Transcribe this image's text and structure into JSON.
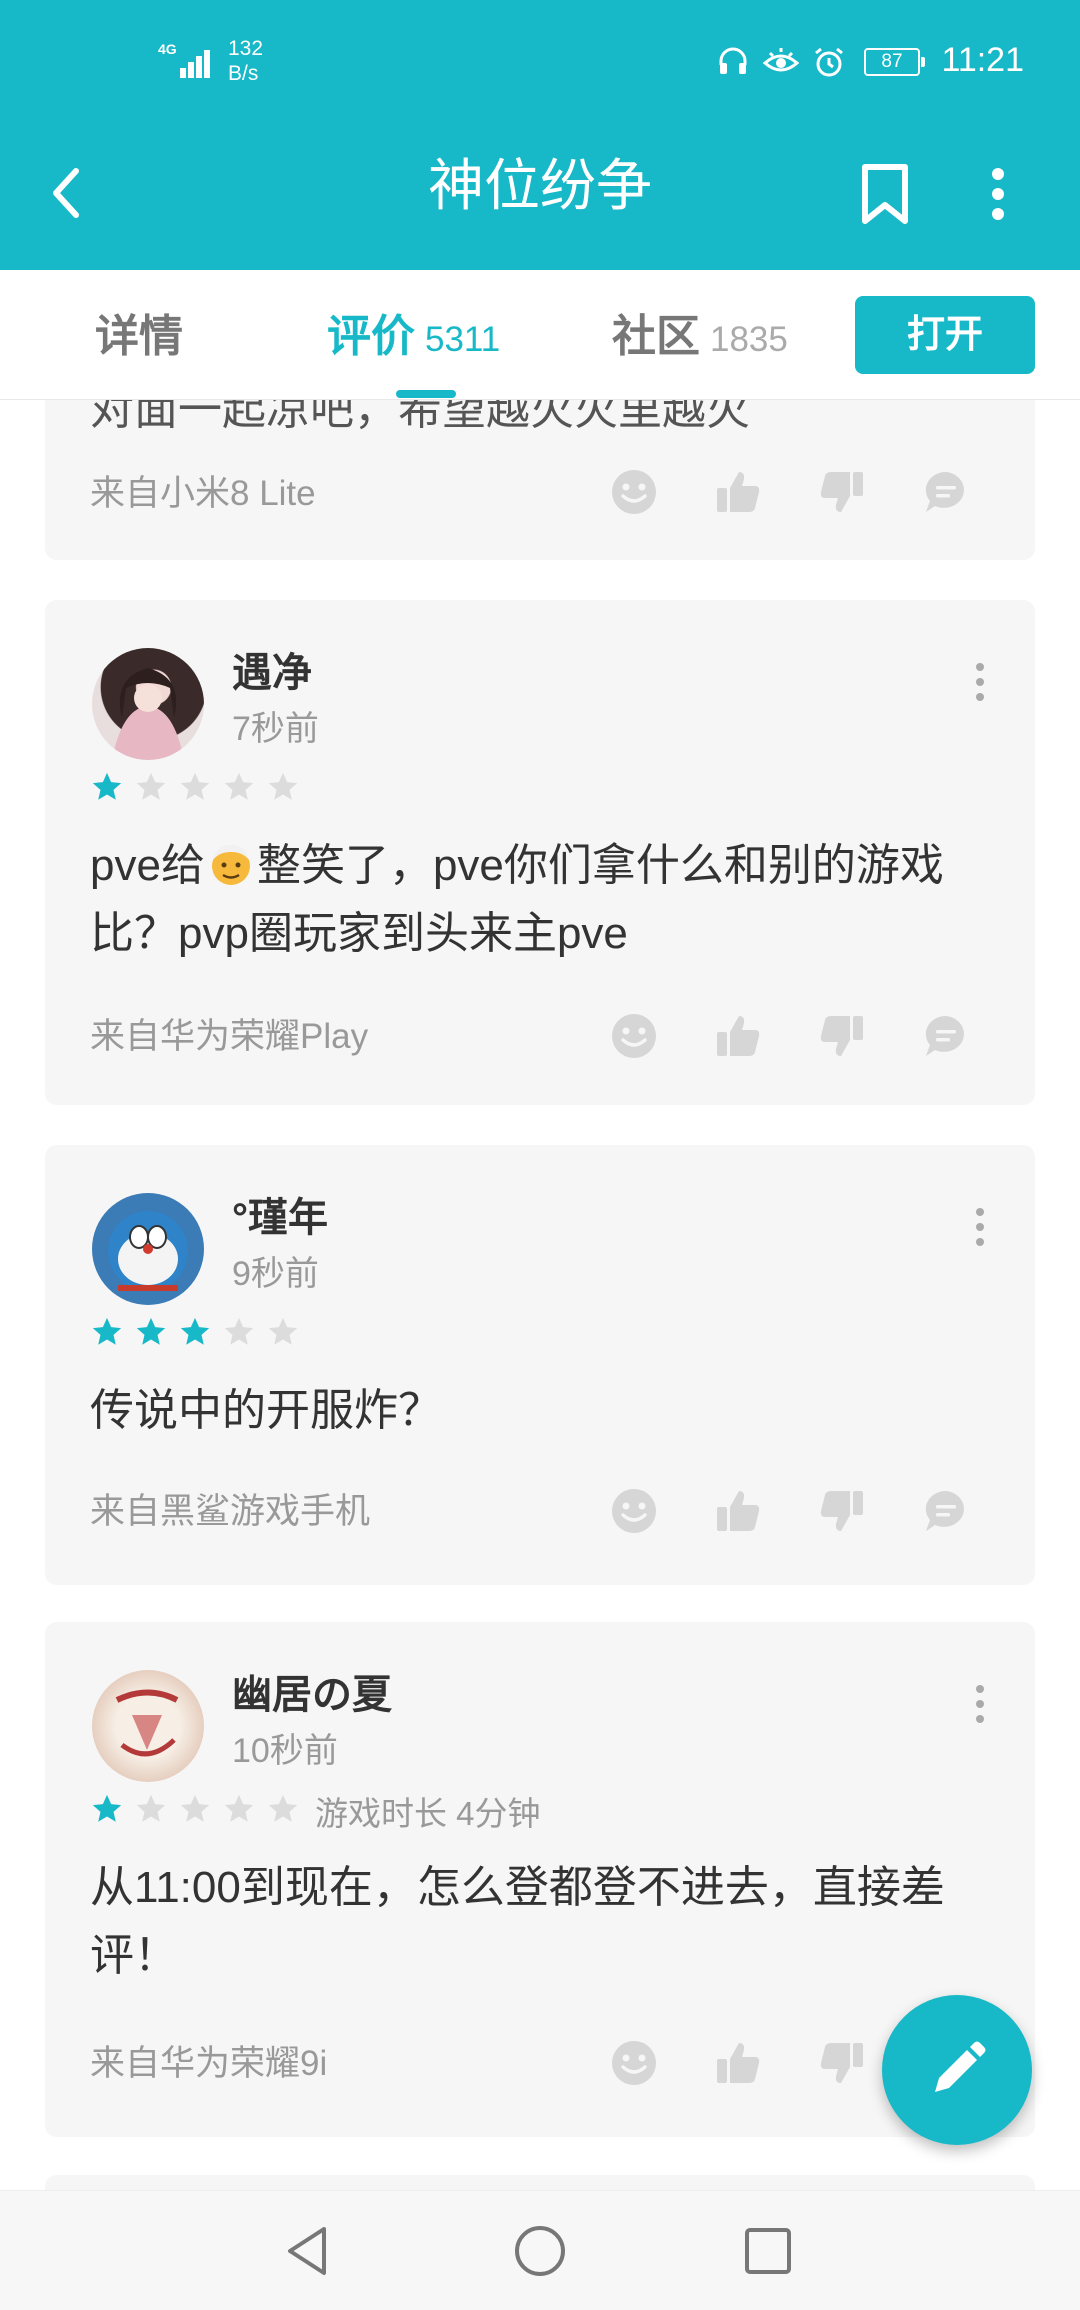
{
  "status_bar": {
    "network_type": "4G",
    "net_speed_value": "132",
    "net_speed_unit": "B/s",
    "battery": "87",
    "time": "11:21"
  },
  "app_bar": {
    "title": "神位纷争"
  },
  "tabs": [
    {
      "label": "详情",
      "count": ""
    },
    {
      "label": "评价",
      "count": "5311"
    },
    {
      "label": "社区",
      "count": "1835"
    }
  ],
  "active_tab": "评价",
  "open_button": "打开",
  "partial_review": {
    "text_fragment": "对面一起凉吧，希望越火火里越火",
    "device": "来自小米8 Lite"
  },
  "reviews": [
    {
      "user": "遇净",
      "time": "7秒前",
      "rating": 1,
      "max_rating": 5,
      "content_before_emoji": "pve给",
      "content_after_emoji": "整笑了，pve你们拿什么和别的游戏比？pvp圈玩家到头来主pve",
      "device": "来自华为荣耀Play"
    },
    {
      "user": "°瑾年",
      "time": "9秒前",
      "rating": 3,
      "max_rating": 5,
      "content": "传说中的开服炸？",
      "device": "来自黑鲨游戏手机"
    },
    {
      "user": "幽居の夏",
      "time": "10秒前",
      "rating": 1,
      "max_rating": 5,
      "play_time": "游戏时长 4分钟",
      "content": "从11:00到现在，怎么登都登不进去，直接差评！",
      "device": "来自华为荣耀9i"
    }
  ],
  "colors": {
    "accent": "#17b8c8",
    "card_bg": "#f6f6f6",
    "star_off": "#dcdcdc",
    "icon_gray": "#d0d0d0"
  }
}
